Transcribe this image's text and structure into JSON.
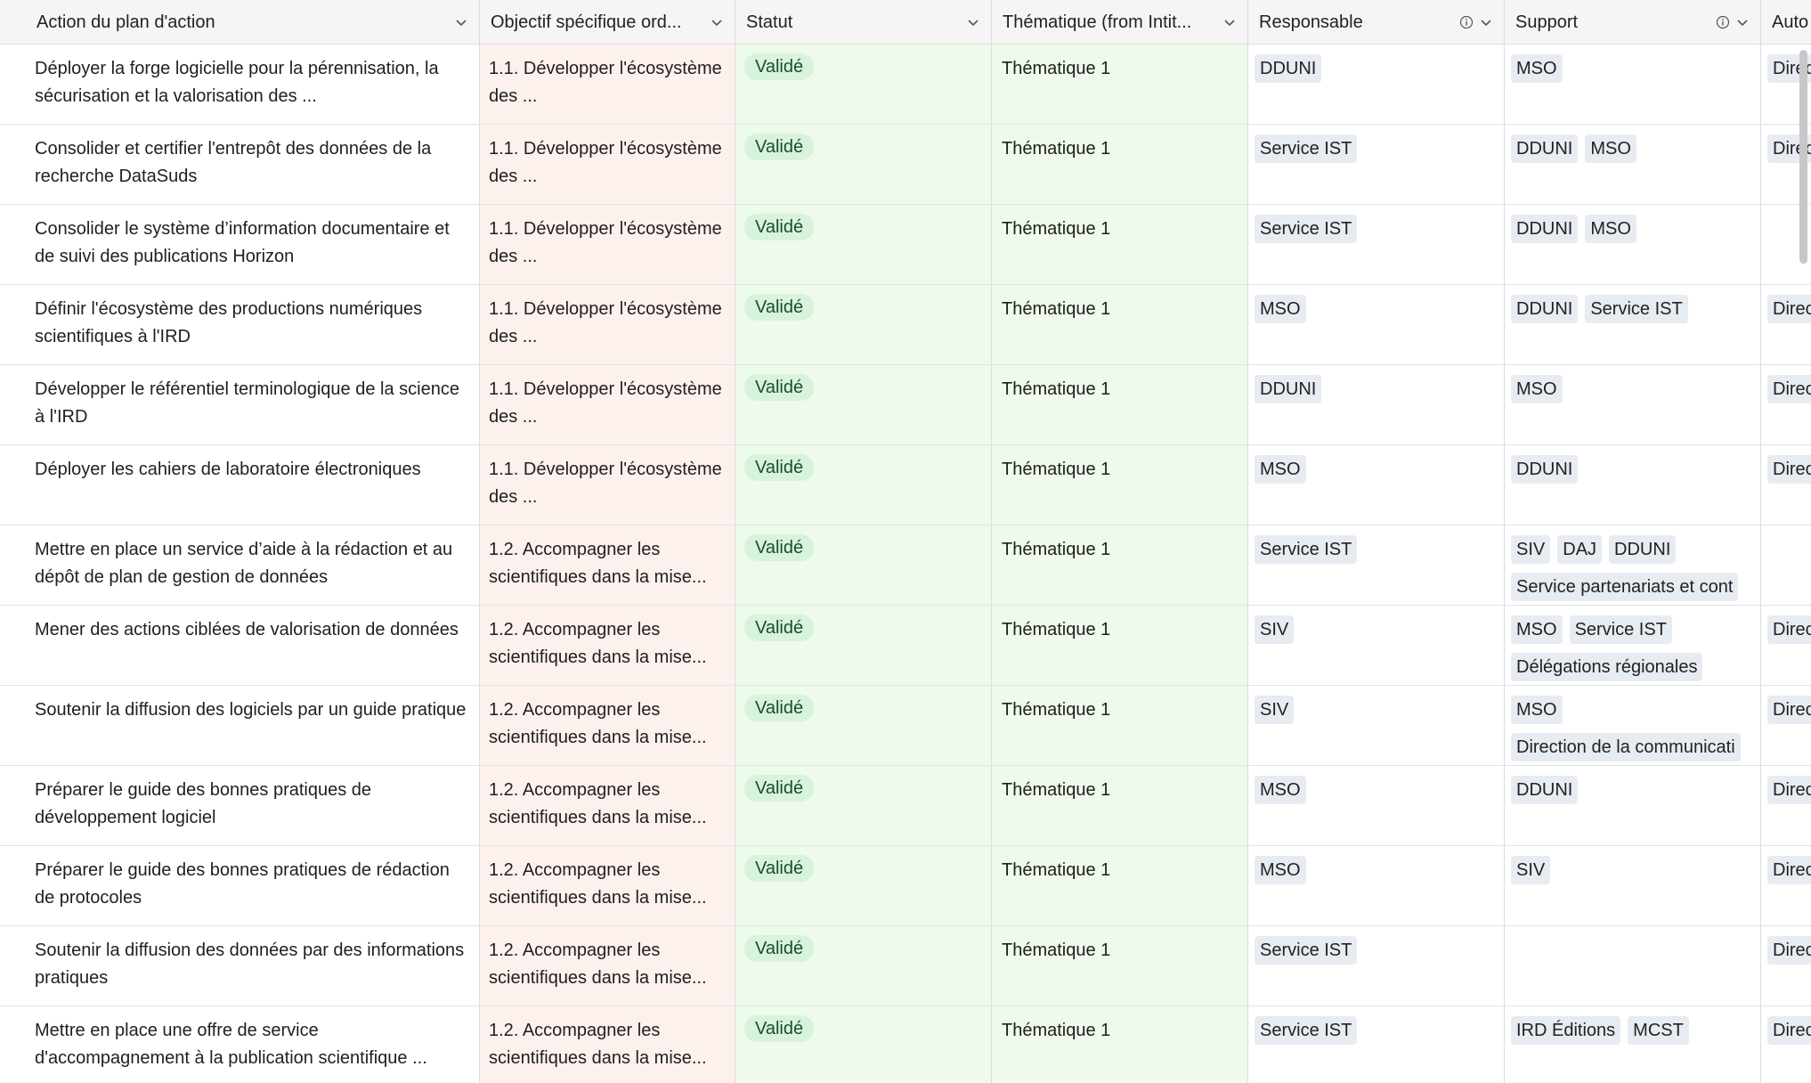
{
  "columns": [
    {
      "key": "action",
      "label": "Action du plan d'action"
    },
    {
      "key": "objectif",
      "label": "Objectif spécifique ord..."
    },
    {
      "key": "statut",
      "label": "Statut"
    },
    {
      "key": "thematique",
      "label": "Thématique (from Intit..."
    },
    {
      "key": "responsable",
      "label": "Responsable"
    },
    {
      "key": "support",
      "label": "Support"
    },
    {
      "key": "auto",
      "label": "Auto"
    }
  ],
  "colors": {
    "objectif_bg": "#fdf1ee",
    "statut_bg": "#eefaeb",
    "thematique_bg": "#eefaeb",
    "status_pill_bg": "#d8f3dc",
    "tag_bg": "#e7ebf2",
    "header_bg": "#f5f5f5"
  },
  "rows": [
    {
      "action": "Déployer la forge logicielle pour la pérennisation, la sécurisation et la valorisation des ...",
      "objectif": "1.1. Développer l'écosystème des ...",
      "statut": "Validé",
      "thematique": "Thématique 1",
      "responsable": [
        "DDUNI"
      ],
      "support": [
        "MSO"
      ],
      "auto": "Direc"
    },
    {
      "action": "Consolider et certifier l'entrepôt des données de la recherche DataSuds",
      "objectif": "1.1. Développer l'écosystème des ...",
      "statut": "Validé",
      "thematique": "Thématique 1",
      "responsable": [
        "Service IST"
      ],
      "support": [
        "DDUNI",
        "MSO"
      ],
      "auto": "Direc"
    },
    {
      "action": "Consolider le système d’information documentaire et de suivi des publications Horizon",
      "objectif": "1.1. Développer l'écosystème des ...",
      "statut": "Validé",
      "thematique": "Thématique 1",
      "responsable": [
        "Service IST"
      ],
      "support": [
        "DDUNI",
        "MSO"
      ],
      "auto": ""
    },
    {
      "action": "Définir l'écosystème des productions numériques scientifiques à l'IRD",
      "objectif": "1.1. Développer l'écosystème des ...",
      "statut": "Validé",
      "thematique": "Thématique 1",
      "responsable": [
        "MSO"
      ],
      "support": [
        "DDUNI",
        "Service IST"
      ],
      "auto": "Direc"
    },
    {
      "action": "Développer le référentiel terminologique de la science à l'IRD",
      "objectif": "1.1. Développer l'écosystème des ...",
      "statut": "Validé",
      "thematique": "Thématique 1",
      "responsable": [
        "DDUNI"
      ],
      "support": [
        "MSO"
      ],
      "auto": "Direc"
    },
    {
      "action": "Déployer les cahiers de laboratoire électroniques",
      "objectif": "1.1. Développer l'écosystème des ...",
      "statut": "Validé",
      "thematique": "Thématique 1",
      "responsable": [
        "MSO"
      ],
      "support": [
        "DDUNI"
      ],
      "auto": "Direc"
    },
    {
      "action": "Mettre en place un service d’aide à la rédaction et au dépôt de plan de gestion de données",
      "objectif": "1.2. Accompagner les scientifiques dans la mise...",
      "statut": "Validé",
      "thematique": "Thématique 1",
      "responsable": [
        "Service IST"
      ],
      "support": [
        "SIV",
        "DAJ",
        "DDUNI",
        "Service partenariats et cont"
      ],
      "auto": ""
    },
    {
      "action": "Mener des actions ciblées de valorisation de données",
      "objectif": "1.2. Accompagner les scientifiques dans la mise...",
      "statut": "Validé",
      "thematique": "Thématique 1",
      "responsable": [
        "SIV"
      ],
      "support": [
        "MSO",
        "Service IST",
        "Délégations régionales"
      ],
      "auto": "Direc"
    },
    {
      "action": "Soutenir la diffusion des logiciels par un guide pratique",
      "objectif": "1.2. Accompagner les scientifiques dans la mise...",
      "statut": "Validé",
      "thematique": "Thématique 1",
      "responsable": [
        "SIV"
      ],
      "support": [
        "MSO",
        "Direction de la communicati"
      ],
      "auto": "Direc"
    },
    {
      "action": "Préparer le guide des bonnes pratiques de développement logiciel",
      "objectif": "1.2. Accompagner les scientifiques dans la mise...",
      "statut": "Validé",
      "thematique": "Thématique 1",
      "responsable": [
        "MSO"
      ],
      "support": [
        "DDUNI"
      ],
      "auto": "Direc"
    },
    {
      "action": "Préparer le guide des bonnes pratiques de rédaction de protocoles",
      "objectif": "1.2. Accompagner les scientifiques dans la mise...",
      "statut": "Validé",
      "thematique": "Thématique 1",
      "responsable": [
        "MSO"
      ],
      "support": [
        "SIV"
      ],
      "auto": "Direc"
    },
    {
      "action": "Soutenir la diffusion des données par des informations pratiques",
      "objectif": "1.2. Accompagner les scientifiques dans la mise...",
      "statut": "Validé",
      "thematique": "Thématique 1",
      "responsable": [
        "Service IST"
      ],
      "support": [],
      "auto": "Direc"
    },
    {
      "action": "Mettre en place une offre de service d'accompagnement à la publication scientifique ...",
      "objectif": "1.2. Accompagner les scientifiques dans la mise...",
      "statut": "Validé",
      "thematique": "Thématique 1",
      "responsable": [
        "Service IST"
      ],
      "support": [
        "IRD Éditions",
        "MCST"
      ],
      "auto": "Direc"
    }
  ]
}
